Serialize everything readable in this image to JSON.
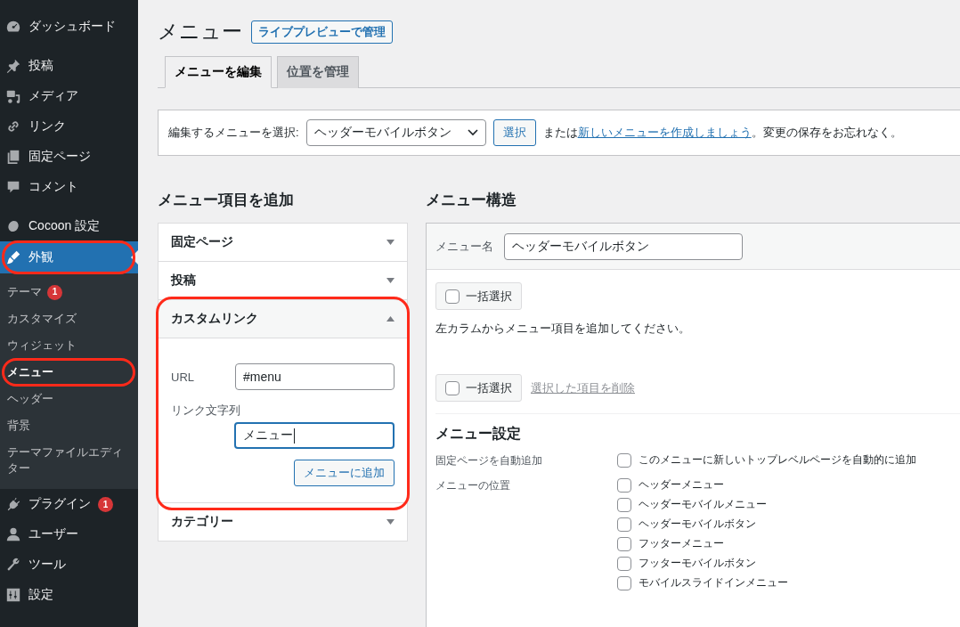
{
  "sidebar": {
    "groups": [
      [
        {
          "label": "ダッシュボード",
          "selected": false,
          "highlighted": false
        }
      ],
      [
        {
          "label": "投稿",
          "selected": false,
          "highlighted": false
        },
        {
          "label": "メディア",
          "selected": false,
          "highlighted": false
        },
        {
          "label": "リンク",
          "selected": false,
          "highlighted": false
        },
        {
          "label": "固定ページ",
          "selected": false,
          "highlighted": false
        },
        {
          "label": "コメント",
          "selected": false,
          "highlighted": false
        }
      ],
      [
        {
          "label": "Cocoon 設定",
          "selected": false,
          "highlighted": false
        },
        {
          "label": "外観",
          "selected": true,
          "highlighted": true,
          "children": [
            {
              "label": "テーマ",
              "badge": "1",
              "selected": false,
              "highlighted": false
            },
            {
              "label": "カスタマイズ",
              "selected": false,
              "highlighted": false
            },
            {
              "label": "ウィジェット",
              "selected": false,
              "highlighted": false
            },
            {
              "label": "メニュー",
              "selected": true,
              "highlighted": true
            },
            {
              "label": "ヘッダー",
              "selected": false,
              "highlighted": false
            },
            {
              "label": "背景",
              "selected": false,
              "highlighted": false
            },
            {
              "label": "テーマファイルエディター",
              "selected": false,
              "highlighted": false
            }
          ]
        },
        {
          "label": "プラグイン",
          "badge": "1",
          "selected": false,
          "highlighted": false
        },
        {
          "label": "ユーザー",
          "selected": false,
          "highlighted": false
        },
        {
          "label": "ツール",
          "selected": false,
          "highlighted": false
        },
        {
          "label": "設定",
          "selected": false,
          "highlighted": false
        }
      ]
    ]
  },
  "page": {
    "title": "メニュー",
    "action_button": "ライブプレビューで管理"
  },
  "tabs": [
    {
      "label": "メニューを編集",
      "selected": true
    },
    {
      "label": "位置を管理",
      "selected": false
    }
  ],
  "menu_select": {
    "label": "編集するメニューを選択:",
    "value": "ヘッダーモバイルボタン",
    "button": "選択",
    "text_before": "または",
    "link": "新しいメニューを作成しましょう",
    "text_after": "。変更の保存をお忘れなく。"
  },
  "add_items": {
    "heading": "メニュー項目を追加",
    "sections": [
      {
        "title": "固定ページ",
        "expanded": false,
        "highlighted": false
      },
      {
        "title": "投稿",
        "expanded": false,
        "highlighted": false
      },
      {
        "title": "カスタムリンク",
        "expanded": true,
        "highlighted": true,
        "fields": [
          {
            "label": "URL",
            "value": "#menu",
            "focused": false
          },
          {
            "label": "リンク文字列",
            "value": "メニュー",
            "focused": true
          }
        ],
        "button": "メニューに追加"
      },
      {
        "title": "カテゴリー",
        "expanded": false,
        "highlighted": false
      }
    ]
  },
  "structure": {
    "heading": "メニュー構造",
    "name_label": "メニュー名",
    "name_value": "ヘッダーモバイルボタン",
    "bulk_top": {
      "label": "一括選択",
      "checked": false
    },
    "instructions": "左カラムからメニュー項目を追加してください。",
    "bulk_bottom": {
      "label": "一括選択",
      "checked": false
    },
    "delete_link": {
      "label": "選択した項目を削除",
      "disabled": true
    },
    "settings": {
      "heading": "メニュー設定",
      "rows": [
        {
          "label": "固定ページを自動追加",
          "options": [
            {
              "label": "このメニューに新しいトップレベルページを自動的に追加",
              "checked": false
            }
          ]
        },
        {
          "label": "メニューの位置",
          "options": [
            {
              "label": "ヘッダーメニュー",
              "checked": false
            },
            {
              "label": "ヘッダーモバイルメニュー",
              "checked": false
            },
            {
              "label": "ヘッダーモバイルボタン",
              "checked": false
            },
            {
              "label": "フッターメニュー",
              "checked": false
            },
            {
              "label": "フッターモバイルボタン",
              "checked": false
            },
            {
              "label": "モバイルスライドインメニュー",
              "checked": false
            }
          ]
        }
      ]
    }
  }
}
